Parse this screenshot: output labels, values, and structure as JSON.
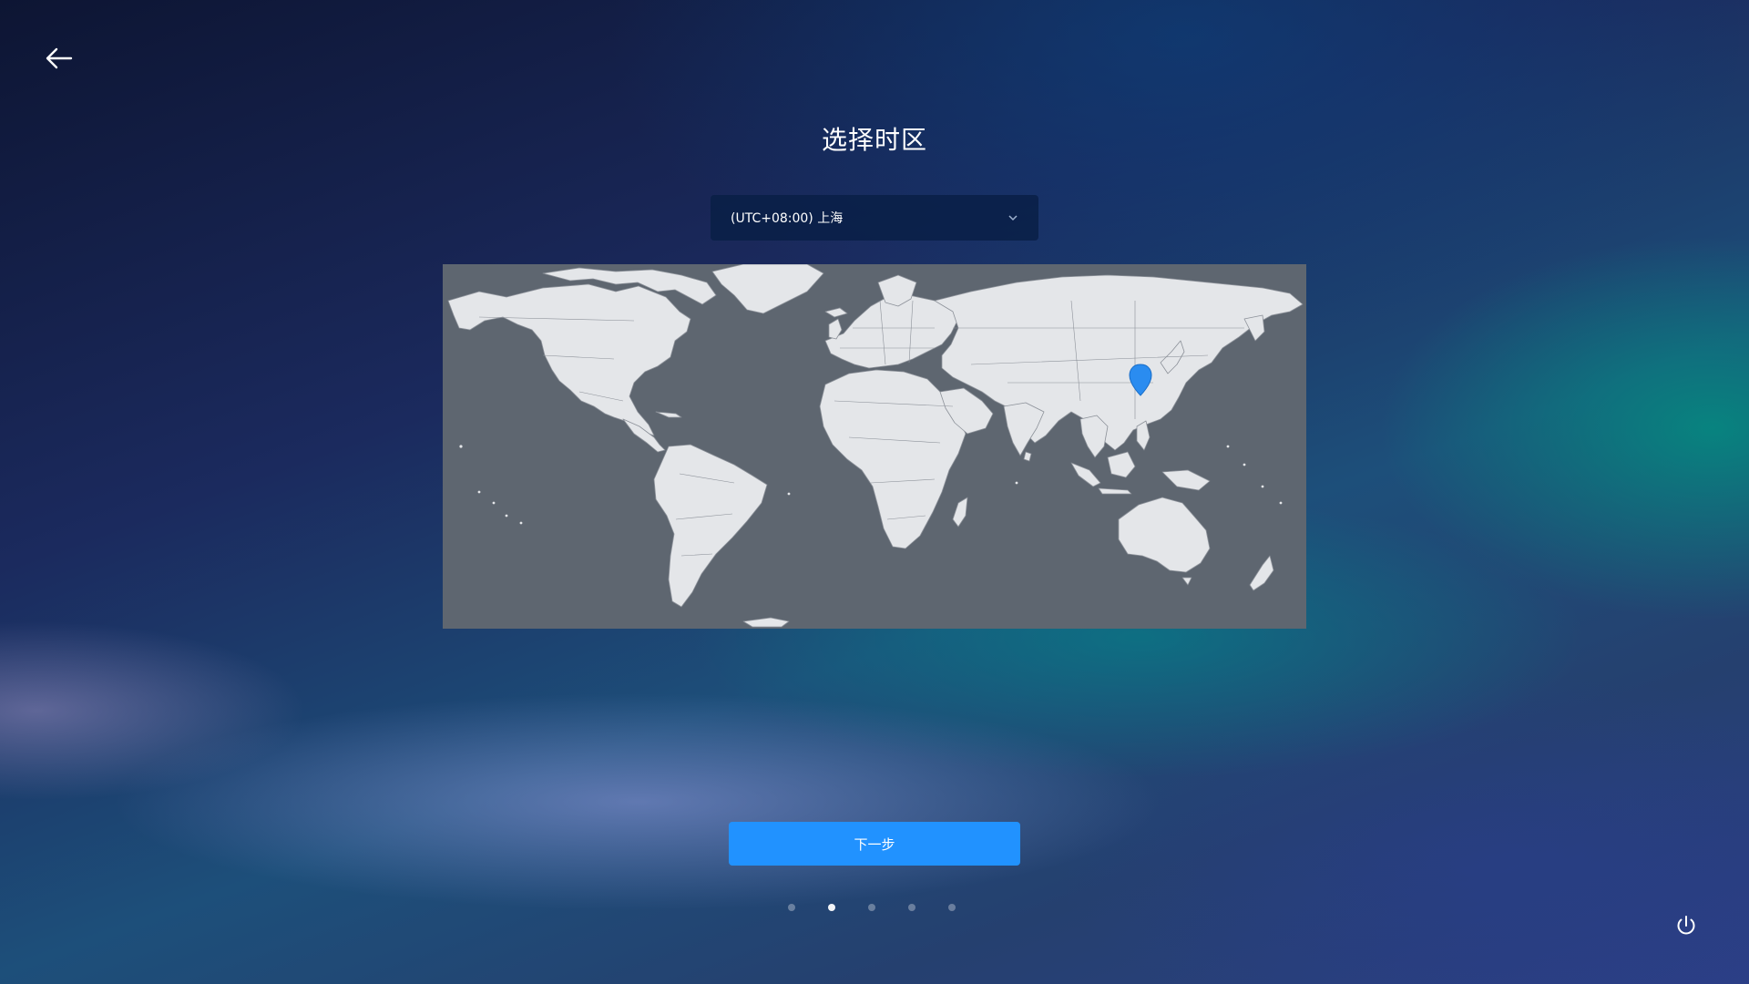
{
  "header": {
    "back_icon": "arrow-left-icon",
    "title": "选择时区"
  },
  "timezone": {
    "selected": "(UTC+08:00) 上海",
    "chevron_icon": "chevron-down-icon"
  },
  "map": {
    "ocean_color": "#5e6670",
    "land_color": "#e4e6e9",
    "border_color": "#8c9199",
    "marker_color": "#2a8cf0",
    "marker_icon": "location-pin-icon",
    "marker_city": "上海"
  },
  "footer": {
    "next_label": "下一步",
    "accent_color": "#2192ff",
    "steps_total": 5,
    "step_current": 2,
    "power_icon": "power-icon"
  }
}
